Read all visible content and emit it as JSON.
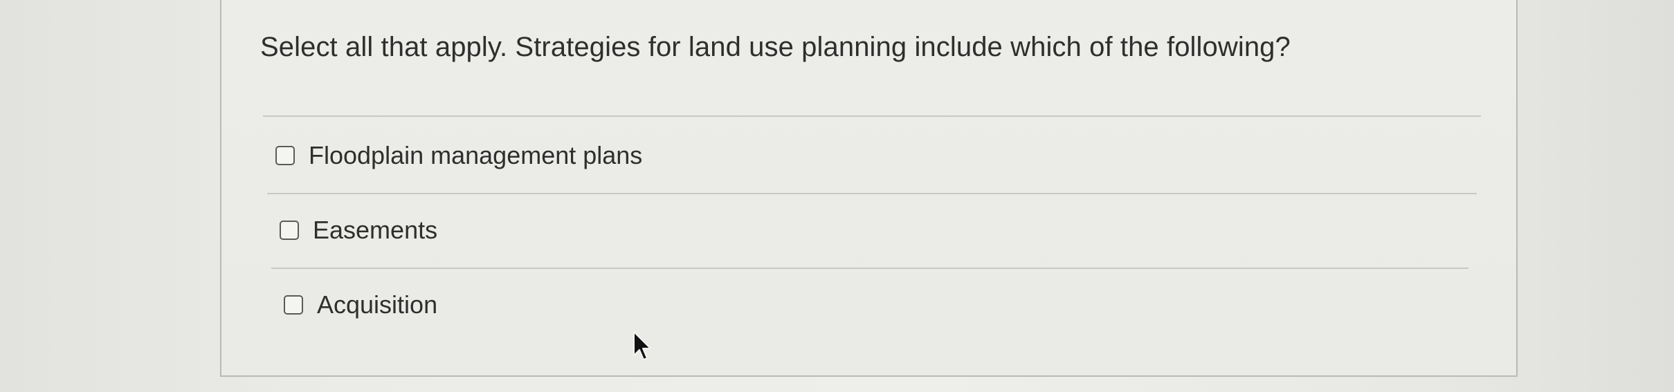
{
  "question": {
    "prompt": "Select all that apply. Strategies for land use planning include which of the following?"
  },
  "options": [
    {
      "label": "Floodplain management plans",
      "checked": false
    },
    {
      "label": "Easements",
      "checked": false
    },
    {
      "label": "Acquisition",
      "checked": false
    }
  ],
  "icons": {
    "checkbox": "checkbox-icon",
    "cursor": "mouse-pointer-icon"
  },
  "colors": {
    "text": "#2e2e2e",
    "border": "#b9b9b6"
  }
}
